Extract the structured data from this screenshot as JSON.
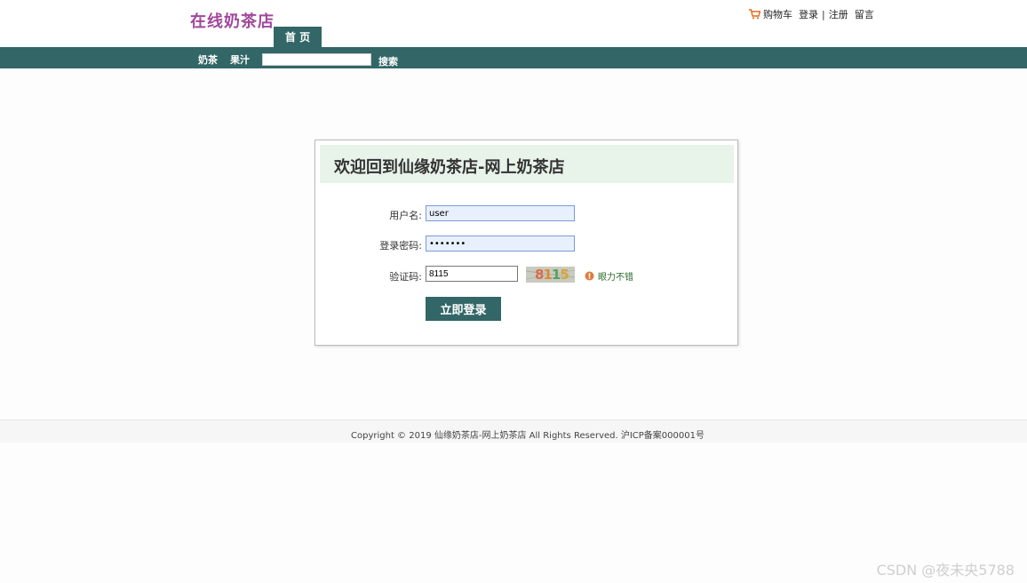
{
  "header": {
    "logo": "在线奶茶店",
    "home_tab": "首 页",
    "links": {
      "cart": "购物车",
      "login": "登录",
      "separator": "|",
      "register": "注册",
      "message": "留言"
    }
  },
  "nav": {
    "items": [
      "奶茶",
      "果汁"
    ],
    "search_value": "",
    "search_button": "搜索"
  },
  "login": {
    "title": "欢迎回到仙缘奶茶店-网上奶茶店",
    "username_label": "用户名:",
    "username_value": "user",
    "password_label": "登录密码:",
    "password_value": "•••••••",
    "captcha_label": "验证码:",
    "captcha_value": "8115",
    "captcha_image_text": "8115",
    "refresh_link": "眼力不错",
    "submit": "立即登录"
  },
  "footer": {
    "copyright": "Copyright © 2019 仙缘奶茶店-网上奶茶店 All Rights Reserved. 沪ICP备案000001号"
  },
  "watermark": "CSDN @夜未央5788",
  "colors": {
    "brand": "#336666",
    "logo": "#a0489c",
    "login_head_bg": "#e8f3ea"
  },
  "icons": {
    "cart": "cart-icon",
    "refresh": "refresh-icon"
  }
}
